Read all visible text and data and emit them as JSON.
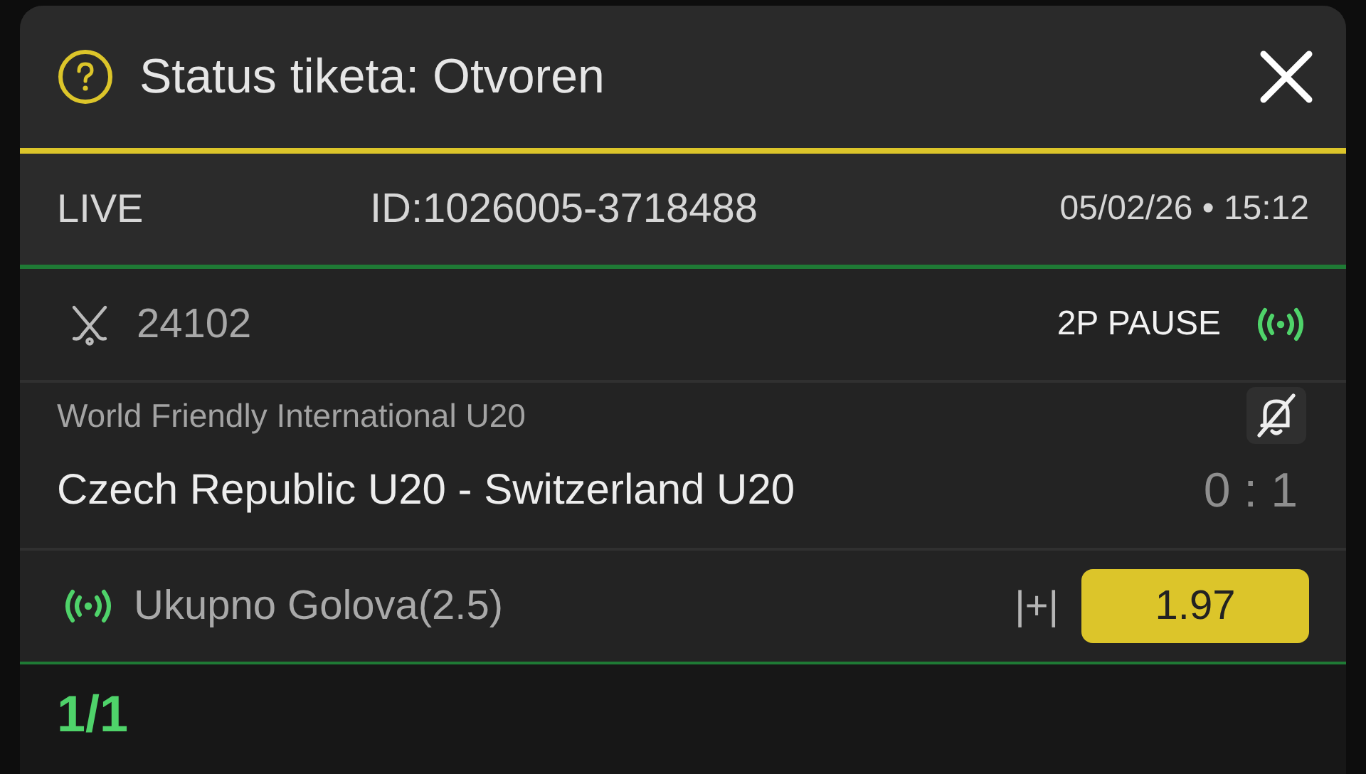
{
  "header": {
    "title": "Status tiketa: Otvoren"
  },
  "ticket": {
    "type": "LIVE",
    "id": "ID:1026005-3718488",
    "datetime": "05/02/26 • 15:12"
  },
  "event": {
    "code": "24102",
    "status": "2P PAUSE",
    "league": "World Friendly International U20",
    "teams": "Czech Republic U20 - Switzerland U20",
    "score": "0 : 1"
  },
  "selection": {
    "market": "Ukupno Golova(2.5)",
    "marker": "|+|",
    "odds": "1.97"
  },
  "footer": {
    "count": "1/1"
  }
}
